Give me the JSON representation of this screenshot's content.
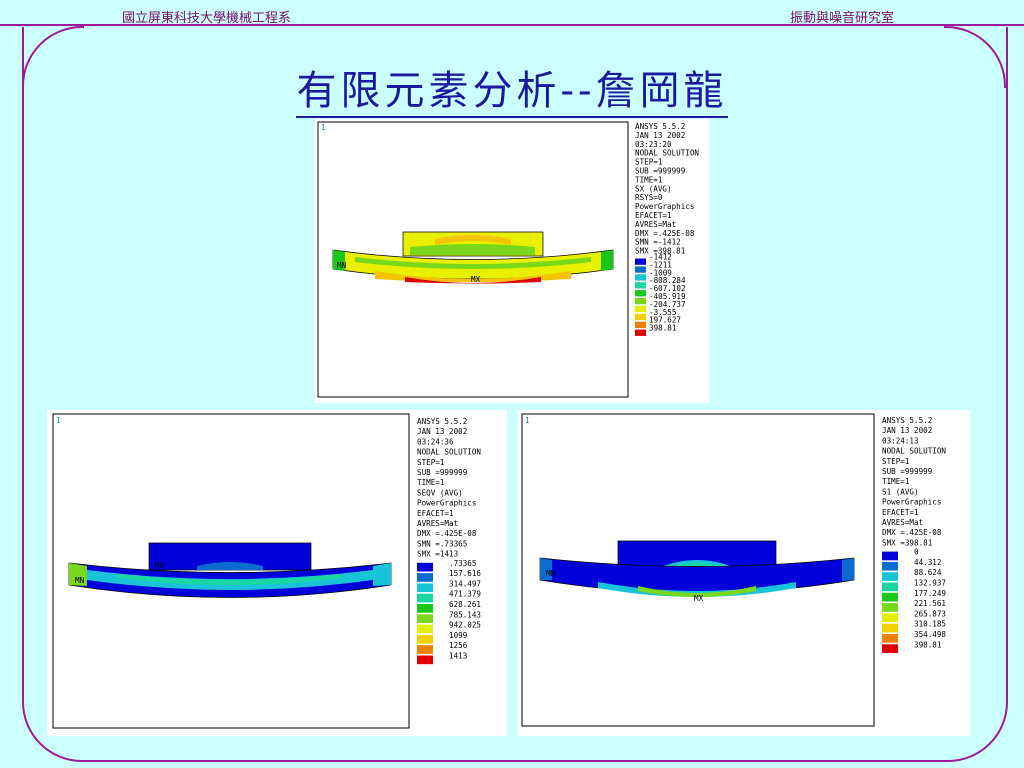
{
  "header": {
    "left": "國立屏東科技大學機械工程系",
    "right": "振動與噪音研究室"
  },
  "title": "有限元素分析--詹岡龍",
  "panels": [
    {
      "id": "sx",
      "info": [
        "ANSYS 5.5.2",
        "JAN 13 2002",
        "03:23:20",
        "NODAL SOLUTION",
        "STEP=1",
        "SUB =999999",
        "TIME=1",
        "SX        (AVG)",
        "RSYS=0",
        "PowerGraphics",
        "EFACET=1",
        "AVRES=Mat",
        "DMX =.425E-08",
        "SMN =-1412",
        "SMX =398.81"
      ],
      "legend_values": [
        "-1412",
        "-1211",
        "-1009",
        "-808.284",
        "-607.102",
        "-405.919",
        "-204.737",
        "-3.555",
        "197.627",
        "398.81"
      ],
      "corner_label": "1",
      "tag_labels": [
        "MN",
        "MX"
      ]
    },
    {
      "id": "seqv",
      "info": [
        "ANSYS 5.5.2",
        "JAN 13 2002",
        "03:24:36",
        "NODAL SOLUTION",
        "STEP=1",
        "SUB =999999",
        "TIME=1",
        "SEQV      (AVG)",
        "PowerGraphics",
        "EFACET=1",
        "AVRES=Mat",
        "DMX =.425E-08",
        "SMN =.73365",
        "SMX =1413"
      ],
      "legend_values": [
        ".73365",
        "157.616",
        "314.497",
        "471.379",
        "628.261",
        "785.143",
        "942.025",
        "1099",
        "1256",
        "1413"
      ],
      "corner_label": "1",
      "tag_labels": [
        "MN",
        "MX"
      ]
    },
    {
      "id": "s1",
      "info": [
        "ANSYS 5.5.2",
        "JAN 13 2002",
        "03:24:13",
        "NODAL SOLUTION",
        "STEP=1",
        "SUB =999999",
        "TIME=1",
        "S1        (AVG)",
        "PowerGraphics",
        "EFACET=1",
        "AVRES=Mat",
        "DMX =.425E-08",
        "SMX =398.81"
      ],
      "legend_values": [
        "0",
        "44.312",
        "88.624",
        "132.937",
        "177.249",
        "221.561",
        "265.873",
        "310.185",
        "354.498",
        "398.81"
      ],
      "corner_label": "1",
      "tag_labels": [
        "MN",
        "MX"
      ]
    }
  ],
  "legend_colors": [
    "#0000d8",
    "#0a6cd0",
    "#19c4d8",
    "#1ad6a0",
    "#1ac818",
    "#7ad81a",
    "#e0f000",
    "#f4d000",
    "#f08000",
    "#e00000"
  ]
}
